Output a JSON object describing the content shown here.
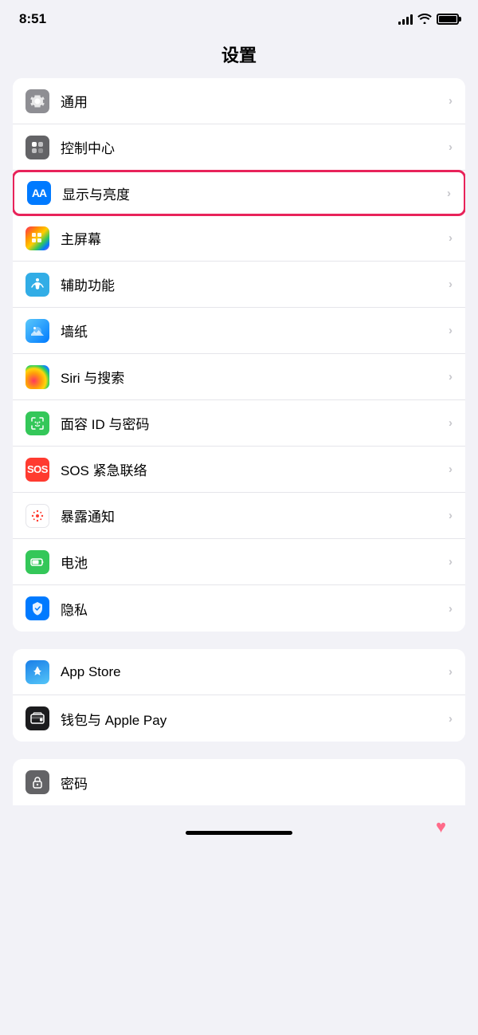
{
  "statusBar": {
    "time": "8:51"
  },
  "pageTitle": "设置",
  "sections": [
    {
      "id": "general-section",
      "rows": [
        {
          "id": "general",
          "label": "通用",
          "iconType": "gear",
          "iconBg": "gray",
          "highlighted": false
        },
        {
          "id": "control-center",
          "label": "控制中心",
          "iconType": "control",
          "iconBg": "dark-gray",
          "highlighted": false
        },
        {
          "id": "display",
          "label": "显示与亮度",
          "iconType": "aa",
          "iconBg": "blue",
          "highlighted": true
        },
        {
          "id": "home-screen",
          "label": "主屏幕",
          "iconType": "grid",
          "iconBg": "colorful",
          "highlighted": false
        },
        {
          "id": "accessibility",
          "label": "辅助功能",
          "iconType": "accessibility",
          "iconBg": "cyan",
          "highlighted": false
        },
        {
          "id": "wallpaper",
          "label": "墙纸",
          "iconType": "wallpaper",
          "iconBg": "teal",
          "highlighted": false
        },
        {
          "id": "siri",
          "label": "Siri 与搜索",
          "iconType": "siri",
          "iconBg": "siri",
          "highlighted": false
        },
        {
          "id": "faceid",
          "label": "面容 ID 与密码",
          "iconType": "faceid",
          "iconBg": "green",
          "highlighted": false
        },
        {
          "id": "sos",
          "label": "SOS 紧急联络",
          "iconType": "sos",
          "iconBg": "red",
          "highlighted": false
        },
        {
          "id": "exposure",
          "label": "暴露通知",
          "iconType": "exposure",
          "iconBg": "exposure",
          "highlighted": false
        },
        {
          "id": "battery",
          "label": "电池",
          "iconType": "battery",
          "iconBg": "battery",
          "highlighted": false
        },
        {
          "id": "privacy",
          "label": "隐私",
          "iconType": "privacy",
          "iconBg": "privacy",
          "highlighted": false
        }
      ]
    },
    {
      "id": "store-section",
      "rows": [
        {
          "id": "appstore",
          "label": "App Store",
          "iconType": "appstore",
          "iconBg": "appstore",
          "highlighted": false
        },
        {
          "id": "wallet",
          "label": "钱包与 Apple Pay",
          "iconType": "wallet",
          "iconBg": "wallet",
          "highlighted": false
        }
      ]
    },
    {
      "id": "password-section",
      "rows": [
        {
          "id": "password",
          "label": "密码",
          "iconType": "password",
          "iconBg": "password",
          "highlighted": false
        }
      ]
    }
  ]
}
